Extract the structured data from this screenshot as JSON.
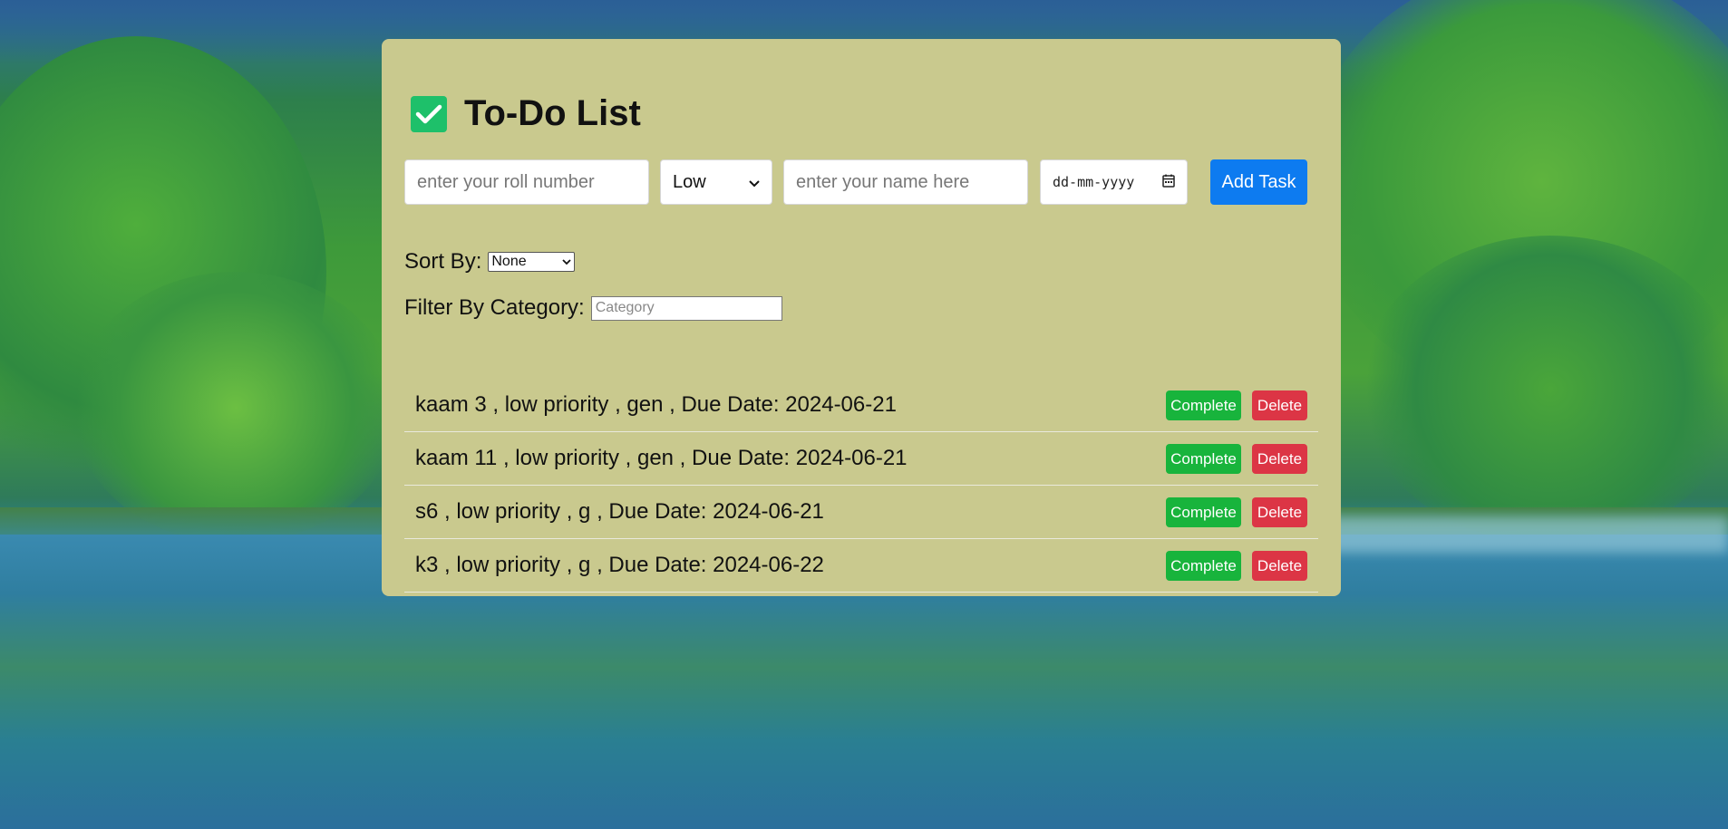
{
  "app": {
    "title": "To-Do List"
  },
  "form": {
    "roll_placeholder": "enter your roll number",
    "priority_selected": "Low",
    "name_placeholder": "enter your name here",
    "date_placeholder": "dd-mm-yyyy",
    "add_label": "Add Task"
  },
  "sort": {
    "label": "Sort By:",
    "selected": "None"
  },
  "filter": {
    "label": "Filter By Category:",
    "placeholder": "Category"
  },
  "tasks": [
    {
      "text": "kaam 3 , low priority , gen , Due Date: 2024-06-21",
      "complete_label": "Complete",
      "delete_label": "Delete"
    },
    {
      "text": "kaam 11 , low priority , gen , Due Date: 2024-06-21",
      "complete_label": "Complete",
      "delete_label": "Delete"
    },
    {
      "text": "s6 , low priority , g , Due Date: 2024-06-21",
      "complete_label": "Complete",
      "delete_label": "Delete"
    },
    {
      "text": "k3 , low priority , g , Due Date: 2024-06-22",
      "complete_label": "Complete",
      "delete_label": "Delete"
    }
  ],
  "icons": {
    "title_icon": "check-box-icon",
    "priority_dropdown": "chevron-down-icon",
    "date_picker": "calendar-icon",
    "sort_dropdown": "chevron-down-icon"
  },
  "colors": {
    "panel": "#c9c98e",
    "check": "#1ec06a",
    "add": "#0d7bf0",
    "complete": "#18b43c",
    "delete": "#dc3545"
  }
}
